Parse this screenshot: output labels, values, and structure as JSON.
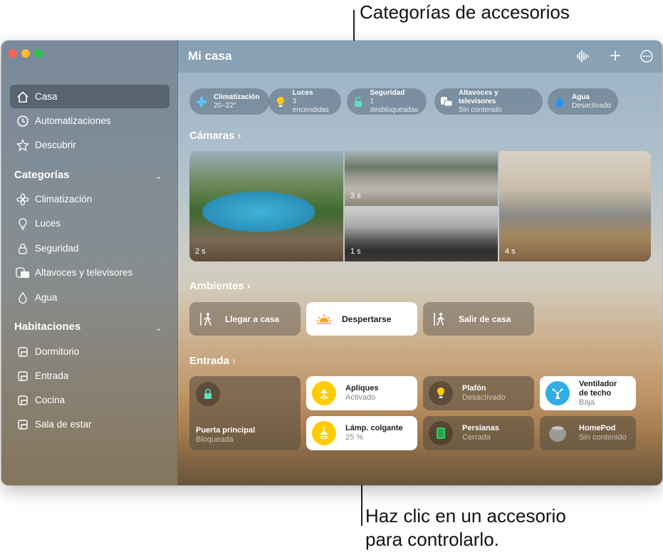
{
  "callouts": {
    "top": "Categorías de accesorios",
    "bottom_line1": "Haz clic en un accesorio",
    "bottom_line2": "para controlarlo."
  },
  "window": {
    "title": "Mi casa"
  },
  "sidebar": {
    "main": [
      {
        "label": "Casa",
        "icon": "house-icon"
      },
      {
        "label": "Automatizaciones",
        "icon": "clock-icon"
      },
      {
        "label": "Descubrir",
        "icon": "star-icon"
      }
    ],
    "categories_heading": "Categorías",
    "categories": [
      {
        "label": "Climatización",
        "icon": "fan-icon"
      },
      {
        "label": "Luces",
        "icon": "bulb-icon"
      },
      {
        "label": "Seguridad",
        "icon": "lock-icon"
      },
      {
        "label": "Altavoces y televisores",
        "icon": "tv-icon"
      },
      {
        "label": "Agua",
        "icon": "drop-icon"
      }
    ],
    "rooms_heading": "Habitaciones",
    "rooms": [
      {
        "label": "Dormitorio"
      },
      {
        "label": "Entrada"
      },
      {
        "label": "Cocina"
      },
      {
        "label": "Sala de estar"
      }
    ]
  },
  "category_pills": [
    {
      "name": "Climatización",
      "status": "20–22°",
      "color": "#5ac8fa"
    },
    {
      "name": "Luces",
      "status": "3 encendidas",
      "color": "#ffcc00"
    },
    {
      "name": "Seguridad",
      "status": "1 desbloqueadas",
      "color": "#5ce0c0"
    },
    {
      "name": "Altavoces y televisores",
      "status": "Sin contenido",
      "color": "#ffffff"
    },
    {
      "name": "Agua",
      "status": "Desactivado",
      "color": "#1e90ff"
    }
  ],
  "cameras": {
    "heading": "Cámaras",
    "chevron": "›",
    "feeds": [
      {
        "time": "2 s"
      },
      {
        "time": "3 s"
      },
      {
        "time": "1 s"
      },
      {
        "time": "4 s"
      }
    ]
  },
  "scenes": {
    "heading": "Ambientes",
    "chevron": "›",
    "items": [
      {
        "label": "Llegar a casa"
      },
      {
        "label": "Despertarse"
      },
      {
        "label": "Salir de casa"
      }
    ]
  },
  "room": {
    "heading": "Entrada",
    "chevron": "›",
    "accessories": [
      {
        "name": "Puerta principal",
        "status": "Bloqueada"
      },
      {
        "name": "Apliques",
        "status": "Activado"
      },
      {
        "name": "Plafón",
        "status": "Desactivado"
      },
      {
        "name_line1": "Ventilador",
        "name_line2": "de techo",
        "status": "Baja"
      },
      {
        "name": "Lámp. colgante",
        "status": "25 %"
      },
      {
        "name": "Persianas",
        "status": "Cerrada"
      },
      {
        "name": "HomePod",
        "status": "Sin contenido"
      }
    ]
  }
}
